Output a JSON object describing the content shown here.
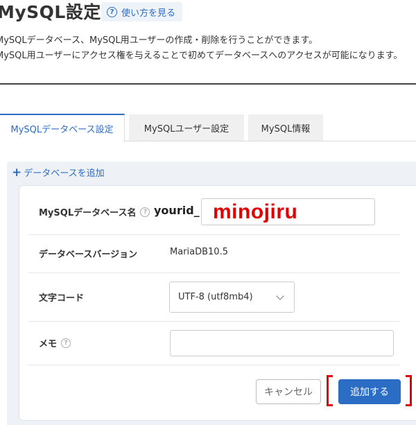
{
  "header": {
    "title": "MySQL設定",
    "help_label": "使い方を見る",
    "description_line1": "MySQLデータベース、MySQL用ユーザーの作成・削除を行うことができます。",
    "description_line2": "MySQL用ユーザーにアクセス権を与えることで初めてデータベースへのアクセスが可能になります。"
  },
  "tabs": [
    {
      "label": "MySQLデータベース設定",
      "active": true
    },
    {
      "label": "MySQLユーザー設定",
      "active": false
    },
    {
      "label": "MySQL情報",
      "active": false
    }
  ],
  "add_panel": {
    "add_link_label": "データベースを追加",
    "fields": {
      "db_name_label": "MySQLデータベース名",
      "db_name_prefix": "yourid_",
      "db_name_value": "minojiru",
      "version_label": "データベースバージョン",
      "version_value": "MariaDB10.5",
      "charset_label": "文字コード",
      "charset_value": "UTF-8 (utf8mb4)",
      "memo_label": "メモ",
      "memo_value": ""
    },
    "buttons": {
      "cancel_label": "キャンセル",
      "submit_label": "追加する"
    }
  },
  "colors": {
    "accent": "#2b6cc4",
    "annotation_red": "#e60000"
  }
}
